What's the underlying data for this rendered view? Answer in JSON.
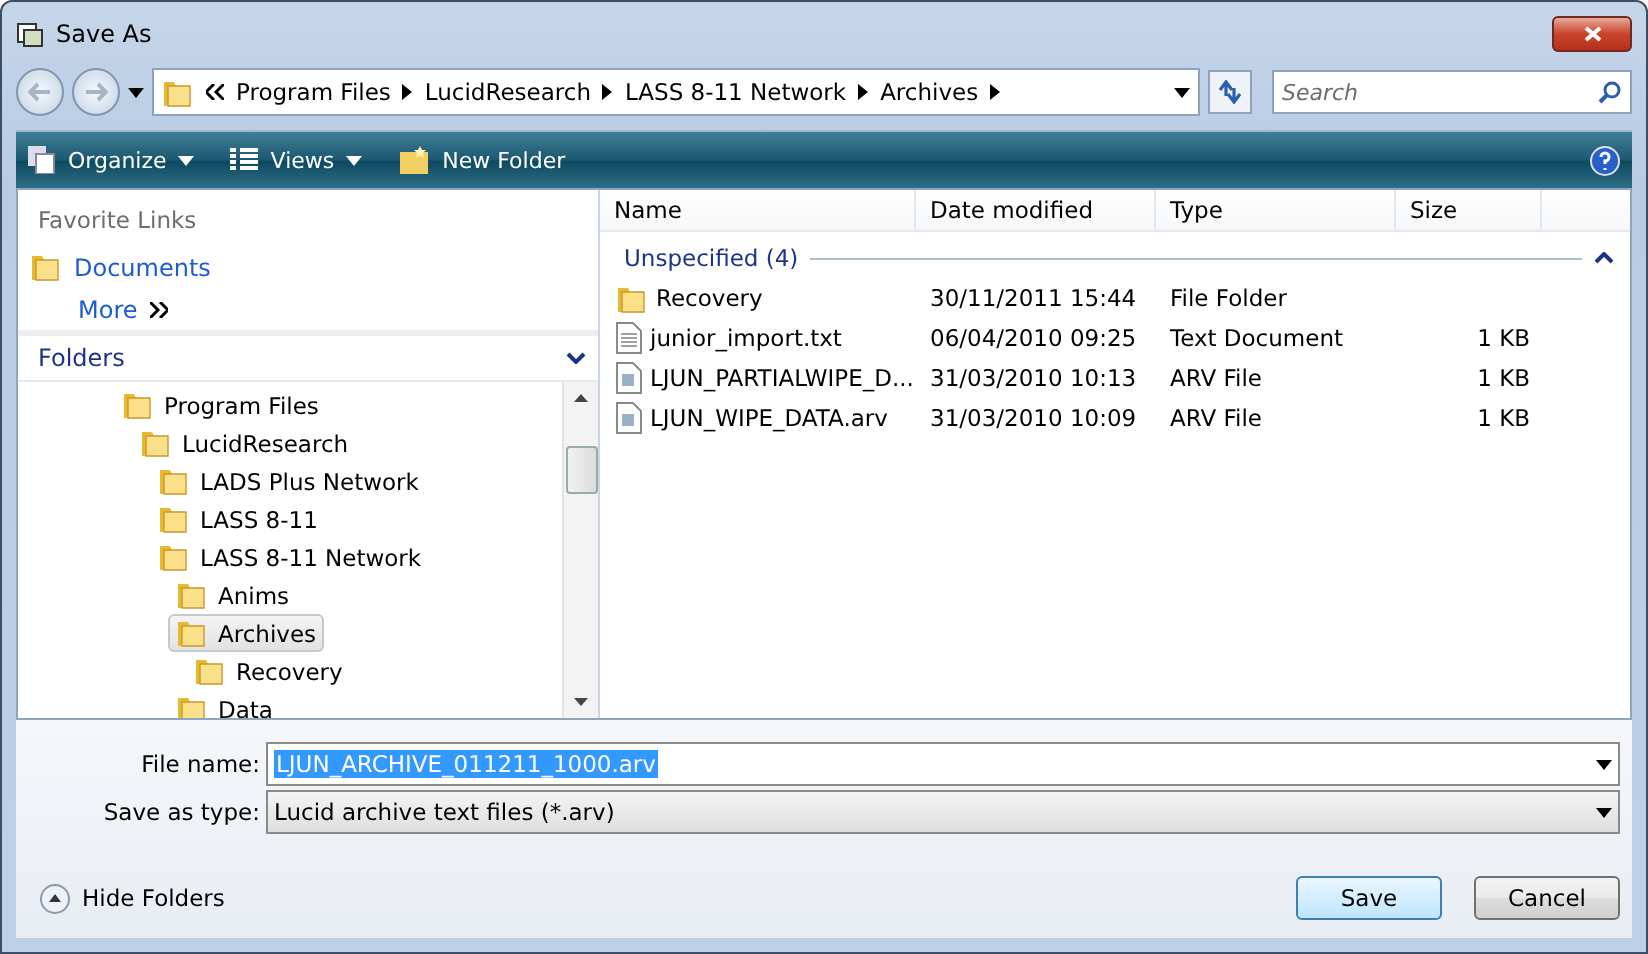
{
  "window": {
    "title": "Save As"
  },
  "address": {
    "crumbs": [
      "Program Files",
      "LucidResearch",
      "LASS 8-11 Network",
      "Archives"
    ]
  },
  "search": {
    "placeholder": "Search"
  },
  "toolbar": {
    "items": [
      {
        "kind": "organize",
        "label": "Organize"
      },
      {
        "kind": "views",
        "label": "Views"
      },
      {
        "kind": "new-folder",
        "label": "New Folder"
      }
    ]
  },
  "favorite_links": {
    "title": "Favorite Links",
    "items": [
      "Documents"
    ],
    "more": "More"
  },
  "folders": {
    "title": "Folders",
    "tree": [
      {
        "label": "Program Files",
        "selected": false,
        "children": [
          {
            "label": "LucidResearch",
            "selected": false,
            "children": [
              {
                "label": "LADS Plus Network",
                "selected": false
              },
              {
                "label": "LASS 8-11",
                "selected": false
              },
              {
                "label": "LASS 8-11 Network",
                "selected": false,
                "children": [
                  {
                    "label": "Anims",
                    "selected": false
                  },
                  {
                    "label": "Archives",
                    "selected": true,
                    "children": [
                      {
                        "label": "Recovery",
                        "selected": false
                      }
                    ]
                  },
                  {
                    "label": "Data",
                    "selected": false
                  }
                ]
              }
            ]
          }
        ]
      }
    ]
  },
  "table": {
    "columns": [
      "Name",
      "Date modified",
      "Type",
      "Size"
    ],
    "group": "Unspecified (4)",
    "rows": [
      {
        "kind": "folder",
        "name": "Recovery",
        "date": "30/11/2011 15:44",
        "type": "File Folder"
      },
      {
        "kind": "text",
        "name": "junior_import.txt",
        "date": "06/04/2010 09:25",
        "type": "Text Document",
        "size": "1 KB"
      },
      {
        "kind": "arv",
        "name": "LJUN_PARTIALWIPE_D...",
        "date": "31/03/2010 10:13",
        "type": "ARV File",
        "size": "1 KB"
      },
      {
        "kind": "arv",
        "name": "LJUN_WIPE_DATA.arv",
        "date": "31/03/2010 10:09",
        "type": "ARV File",
        "size": "1 KB"
      }
    ]
  },
  "file_name": {
    "label": "File name:",
    "value": "LJUN_ARCHIVE_011211_1000.arv"
  },
  "save_as_type": {
    "label": "Save as type:",
    "value": "Lucid archive text files (*.arv)"
  },
  "hide_folders": "Hide Folders",
  "buttons": [
    {
      "kind": "default",
      "label": "Save"
    },
    {
      "kind": "normal",
      "label": "Cancel"
    }
  ]
}
